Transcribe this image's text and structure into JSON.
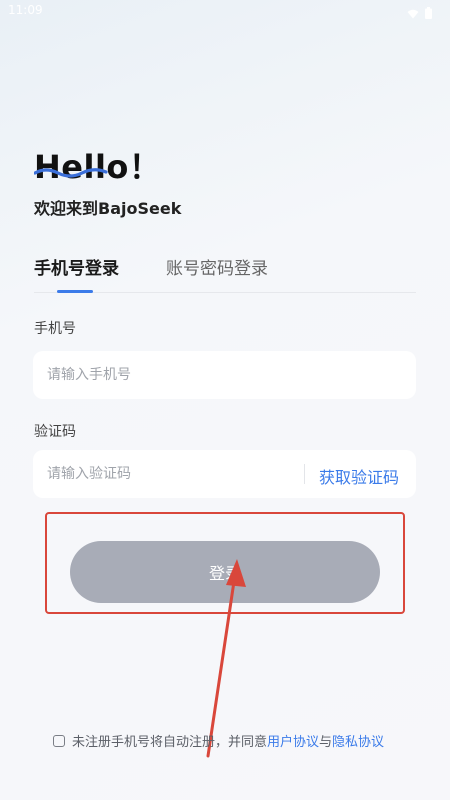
{
  "status_bar": {
    "time": "11:09",
    "icons": [
      "wifi-icon",
      "battery-icon"
    ]
  },
  "header": {
    "greeting": "Hello！",
    "welcome": "欢迎来到BajoSeek"
  },
  "tabs": [
    {
      "label": "手机号登录",
      "active": true
    },
    {
      "label": "账号密码登录",
      "active": false
    }
  ],
  "form": {
    "phone": {
      "label": "手机号",
      "placeholder": "请输入手机号",
      "value": ""
    },
    "code": {
      "label": "验证码",
      "placeholder": "请输入验证码",
      "value": "",
      "get_code_label": "获取验证码"
    },
    "login_label": "登录"
  },
  "agreement": {
    "checked": false,
    "prefix": "未注册手机号将自动注册，并同意",
    "user_agreement": "用户协议",
    "and": "与",
    "privacy_policy": "隐私协议"
  },
  "colors": {
    "accent": "#3b7be9",
    "login_button": "#a8acb7",
    "annotation": "#d9473b"
  }
}
